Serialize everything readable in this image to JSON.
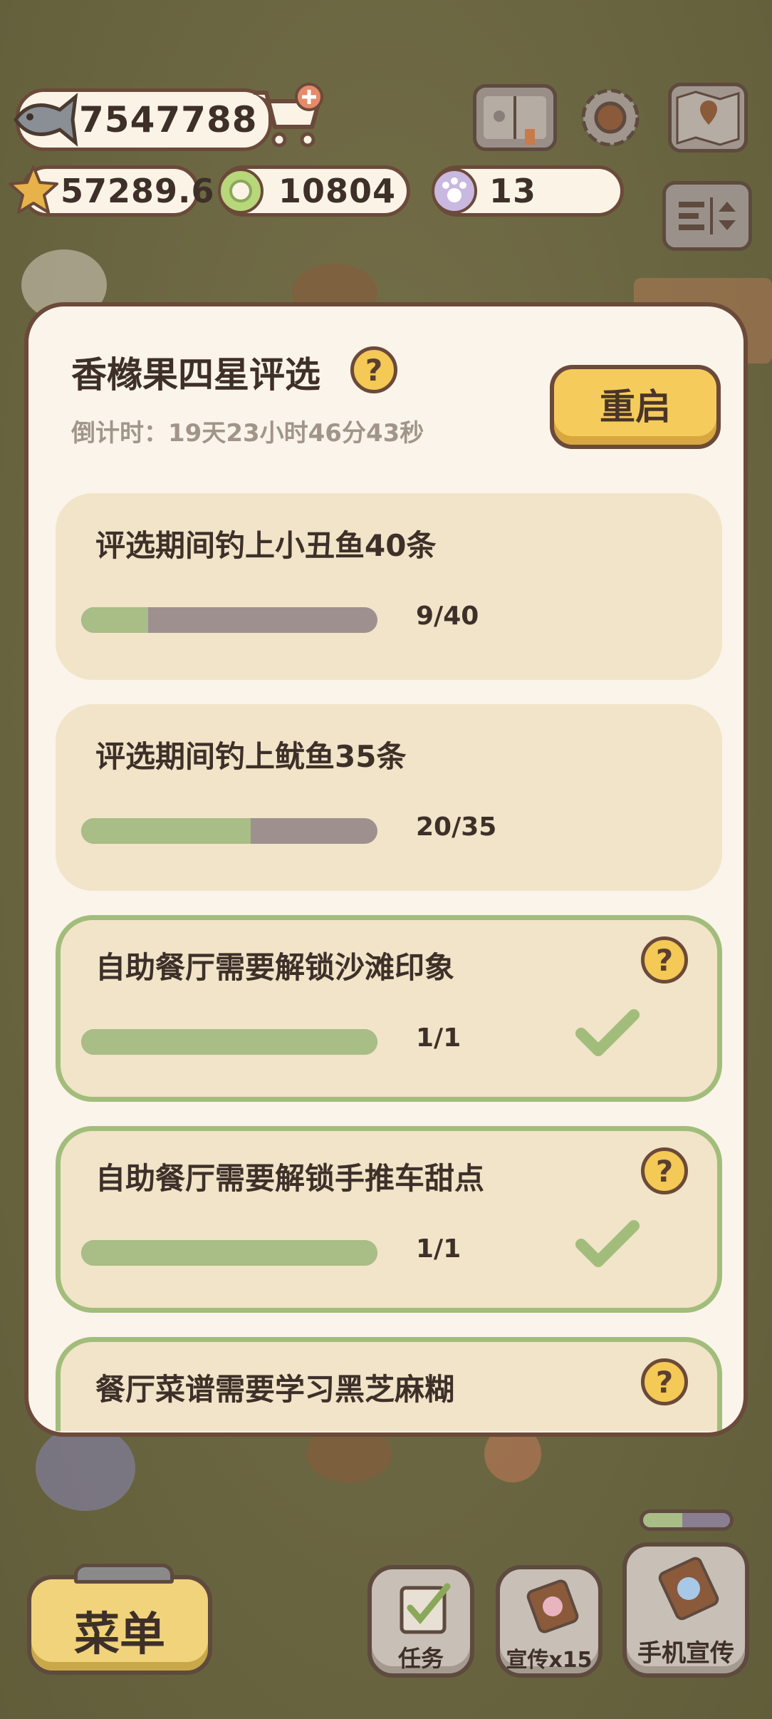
{
  "resources": {
    "fish": {
      "icon": "fish-icon",
      "value": "7547788"
    },
    "star": {
      "icon": "star-icon",
      "value": "57289.6"
    },
    "coin": {
      "icon": "green-coin-icon",
      "value": "10804"
    },
    "paw": {
      "icon": "paw-token-icon",
      "value": "13"
    }
  },
  "top_buttons": [
    "shop-cart-icon",
    "book-icon",
    "gear-icon",
    "map-icon",
    "toggle-layout-icon"
  ],
  "panel": {
    "title": "香橼果四星评选",
    "countdown": "倒计时：19天23小时46分43秒",
    "restart_label": "重启",
    "help_symbol": "?"
  },
  "tasks": [
    {
      "title": "评选期间钓上小丑鱼40条",
      "count": "9/40",
      "progress": 0.225,
      "done": false
    },
    {
      "title": "评选期间钓上鱿鱼35条",
      "count": "20/35",
      "progress": 0.571,
      "done": false
    },
    {
      "title": "自助餐厅需要解锁沙滩印象",
      "count": "1/1",
      "progress": 1.0,
      "done": true
    },
    {
      "title": "自助餐厅需要解锁手推车甜点",
      "count": "1/1",
      "progress": 1.0,
      "done": true
    },
    {
      "title": "餐厅菜谱需要学习黑芝麻糊",
      "count": "",
      "progress": 0,
      "done": false,
      "has_help": true
    }
  ],
  "bottom": {
    "menu_label": "菜单",
    "tasks_label": "任务",
    "promote_label": "宣传x15",
    "phone_promote_label": "手机宣传",
    "phone_progress": 0.45
  },
  "colors": {
    "panel_bg": "#faf4ea",
    "task_bg": "#f1e4c8",
    "accent_yellow": "#f5cb5c",
    "progress_green": "#a9bd86",
    "done_border": "#a2bd7b"
  }
}
